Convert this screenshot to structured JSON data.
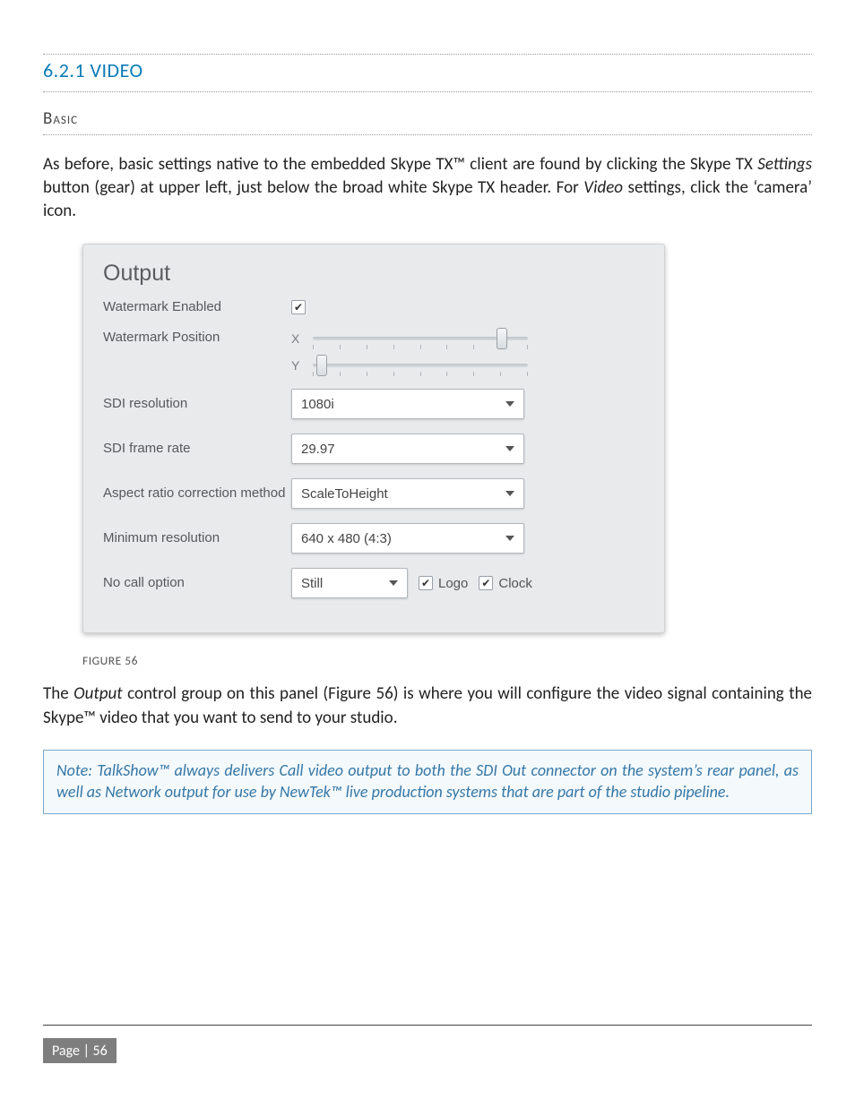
{
  "section": {
    "title": "6.2.1 VIDEO"
  },
  "sub": {
    "title": "Basic"
  },
  "intro": {
    "part1": "As before, basic settings native to the embedded Skype TX™ client are found by clicking the Skype TX ",
    "settings_ital": "Settings",
    "part2": " button (gear) at upper left, just below the broad white Skype TX header.   For ",
    "video_ital": "Video",
    "part3": " settings, click the ‘camera’ icon."
  },
  "panel": {
    "title": "Output",
    "rows": {
      "watermark_enabled": {
        "label": "Watermark Enabled",
        "checked": true
      },
      "watermark_position": {
        "label": "Watermark Position",
        "x_label": "X",
        "y_label": "Y",
        "x_pct": 88,
        "y_pct": 4
      },
      "sdi_resolution": {
        "label": "SDI resolution",
        "value": "1080i"
      },
      "sdi_frame_rate": {
        "label": "SDI frame rate",
        "value": "29.97"
      },
      "aspect": {
        "label": "Aspect ratio correction method",
        "value": "ScaleToHeight"
      },
      "min_res": {
        "label": "Minimum resolution",
        "value": "640 x 480 (4:3)"
      },
      "no_call": {
        "label": "No call option",
        "select_value": "Still",
        "logo_label": "Logo",
        "logo_checked": true,
        "clock_label": "Clock",
        "clock_checked": true
      }
    }
  },
  "figure_caption": "FIGURE 56",
  "post_figure": {
    "p1a": "The ",
    "p1b_ital": "Output",
    "p1c": " control group on this panel (Figure 56) is where you will configure the video signal containing the Skype™ video that you want to send to your studio."
  },
  "note": "Note: TalkShow™ always delivers Call video output to both the SDI Out connector on the system’s rear panel, as well as Network output for use by NewTek™ live production systems that are part of the studio pipeline.",
  "footer": {
    "page_label": "Page | 56"
  }
}
